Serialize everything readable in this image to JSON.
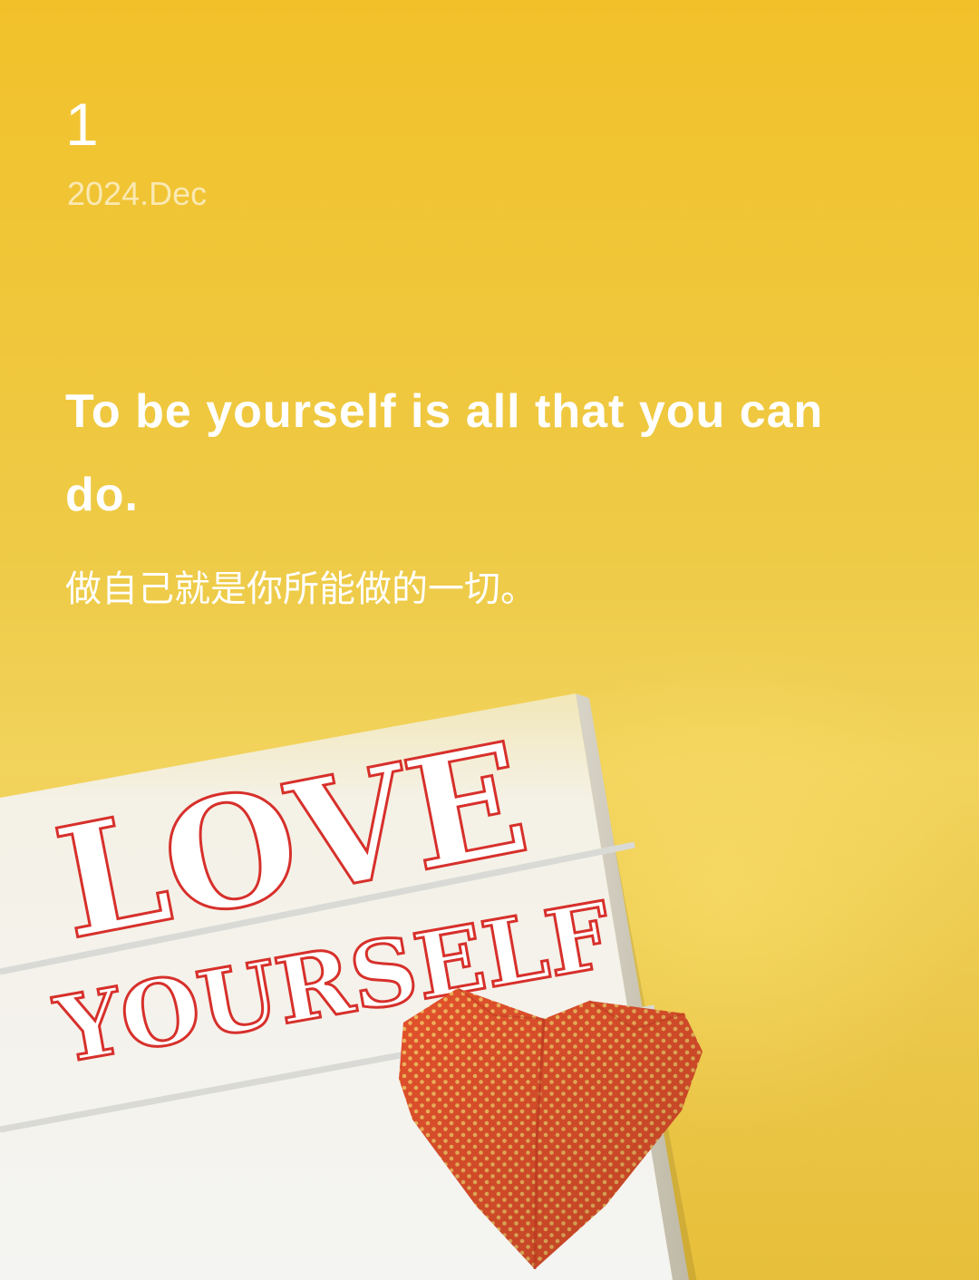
{
  "date": {
    "day": "1",
    "month": "2024.Dec"
  },
  "quote": {
    "english": "To be yourself is all that you can do.",
    "chinese": "做自己就是你所能做的一切。"
  },
  "photo": {
    "line1": "LOVE",
    "line2": "YOURSELF",
    "background_color": "#f2c12a",
    "letter_color": "#d7302b",
    "heart_color": "#e4502d"
  }
}
